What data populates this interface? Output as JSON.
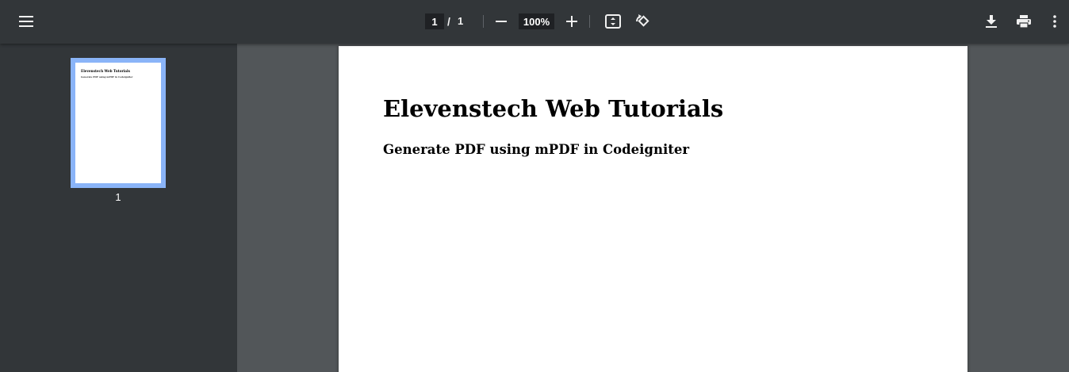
{
  "toolbar": {
    "menu_icon": "menu-icon",
    "page_current": "1",
    "page_separator": "/",
    "page_total": "1",
    "zoom_out_icon": "minus-icon",
    "zoom_value": "100%",
    "zoom_in_icon": "plus-icon",
    "fit_icon": "fit-to-page-icon",
    "rotate_icon": "rotate-counterclockwise-icon",
    "download_icon": "download-icon",
    "print_icon": "print-icon",
    "more_icon": "more-vert-icon"
  },
  "sidebar": {
    "thumbnails": [
      {
        "label": "1",
        "title": "Elevenstech Web Tutorials",
        "subtitle": "Generate PDF using mPDF in Codeigniter",
        "selected": true
      }
    ]
  },
  "document": {
    "title": "Elevenstech Web Tutorials",
    "subtitle": "Generate PDF using mPDF in Codeigniter"
  },
  "colors": {
    "toolbar_bg": "#323639",
    "sidebar_bg": "#323639",
    "viewer_bg": "#525659",
    "thumbnail_highlight": "#8ab4f8",
    "page_bg": "#ffffff"
  }
}
